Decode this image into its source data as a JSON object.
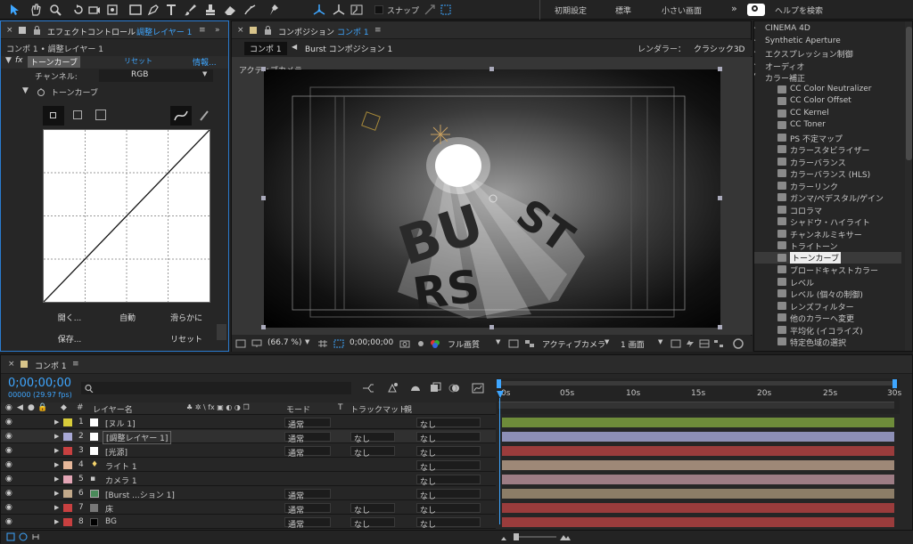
{
  "toolbar": {
    "snap_label": "スナップ",
    "workspace_default": "初期設定",
    "workspace_standard": "標準",
    "workspace_small": "小さい画面",
    "help_search": "ヘルプを検索"
  },
  "effects": {
    "tab_close": "×",
    "tab_label": "エフェクトコントロール",
    "tab_layer": "調整レイヤー 1",
    "breadcrumb": "コンポ 1 • 調整レイヤー 1",
    "fx_name": "トーンカーブ",
    "reset": "リセット",
    "info": "情報...",
    "channel_label": "チャンネル:",
    "channel_value": "RGB",
    "sub_label": "トーンカーブ",
    "btn_open": "開く...",
    "btn_auto": "自動",
    "btn_smooth": "滑らかに",
    "btn_save": "保存...",
    "btn_reset": "リセット"
  },
  "comp": {
    "tab_label": "コンポジション",
    "tab_name": "コンポ 1",
    "crumb1": "コンポ 1",
    "crumb2": "Burst コンポジション 1",
    "renderer_label": "レンダラー：",
    "renderer_value": "クラシック3D",
    "camera_label": "アクティブカメラ",
    "zoom": "(66.7 %)",
    "timecode": "0;00;00;00",
    "quality": "フル画質",
    "view": "アクティブカメラ",
    "views": "1 画面"
  },
  "effects_list": {
    "items": [
      {
        "label": "CINEMA 4D",
        "type": "folder"
      },
      {
        "label": "Synthetic Aperture",
        "type": "folder"
      },
      {
        "label": "エクスプレッション制御",
        "type": "folder"
      },
      {
        "label": "オーディオ",
        "type": "folder"
      },
      {
        "label": "カラー補正",
        "type": "open"
      },
      {
        "label": "CC Color Neutralizer",
        "type": "fx"
      },
      {
        "label": "CC Color Offset",
        "type": "fx"
      },
      {
        "label": "CC Kernel",
        "type": "fx"
      },
      {
        "label": "CC Toner",
        "type": "fx"
      },
      {
        "label": "PS 不定マップ",
        "type": "fx"
      },
      {
        "label": "カラースタビライザー",
        "type": "fx"
      },
      {
        "label": "カラーバランス",
        "type": "fx"
      },
      {
        "label": "カラーバランス (HLS)",
        "type": "fx"
      },
      {
        "label": "カラーリンク",
        "type": "fx"
      },
      {
        "label": "ガンマ/ペデスタル/ゲイン",
        "type": "fx"
      },
      {
        "label": "コロラマ",
        "type": "fx"
      },
      {
        "label": "シャドウ・ハイライト",
        "type": "fx"
      },
      {
        "label": "チャンネルミキサー",
        "type": "fx"
      },
      {
        "label": "トライトーン",
        "type": "fx"
      },
      {
        "label": "トーンカーブ",
        "type": "selected"
      },
      {
        "label": "ブロードキャストカラー",
        "type": "fx"
      },
      {
        "label": "レベル",
        "type": "fx"
      },
      {
        "label": "レベル (個々の制御)",
        "type": "fx"
      },
      {
        "label": "レンズフィルター",
        "type": "fx"
      },
      {
        "label": "他のカラーへ変更",
        "type": "fx"
      },
      {
        "label": "平均化 (イコライズ)",
        "type": "fx"
      },
      {
        "label": "特定色域の選択",
        "type": "fx"
      }
    ]
  },
  "timeline": {
    "tab_name": "コンポ 1",
    "timecode": "0;00;00;00",
    "fps": "00000 (29.97 fps)",
    "col_num": "#",
    "col_layer": "レイヤー名",
    "col_mode": "モード",
    "col_t": "T",
    "col_track": "トラックマット",
    "col_parent": "親",
    "ruler": [
      "0s",
      "05s",
      "10s",
      "15s",
      "20s",
      "25s",
      "30s"
    ],
    "layers": [
      {
        "num": "1",
        "name": "[ヌル 1]",
        "color": "#d8cc3a",
        "mode": "通常",
        "track": "",
        "parent": "なし",
        "bar": "#6e8c3a"
      },
      {
        "num": "2",
        "name": "[調整レイヤー 1]",
        "color": "#a9a9d6",
        "mode": "通常",
        "track": "なし",
        "parent": "なし",
        "bar": "#8d8fb6"
      },
      {
        "num": "3",
        "name": "[光源]",
        "color": "#c84040",
        "mode": "通常",
        "track": "なし",
        "parent": "なし",
        "bar": "#9a3c3c"
      },
      {
        "num": "4",
        "name": "ライト 1",
        "color": "#e6b79a",
        "mode": "",
        "track": "",
        "parent": "なし",
        "bar": "#9e8877"
      },
      {
        "num": "5",
        "name": "カメラ 1",
        "color": "#e3a5b5",
        "mode": "",
        "track": "",
        "parent": "なし",
        "bar": "#9d7c84"
      },
      {
        "num": "6",
        "name": "[Burst ...ション 1]",
        "color": "#c2a98a",
        "mode": "通常",
        "track": "",
        "parent": "なし",
        "bar": "#8c7d67"
      },
      {
        "num": "7",
        "name": "床",
        "color": "#c84040",
        "mode": "通常",
        "track": "なし",
        "parent": "なし",
        "bar": "#9a3c3c"
      },
      {
        "num": "8",
        "name": "BG",
        "color": "#c84040",
        "mode": "通常",
        "track": "なし",
        "parent": "なし",
        "bar": "#9a3c3c"
      }
    ]
  }
}
